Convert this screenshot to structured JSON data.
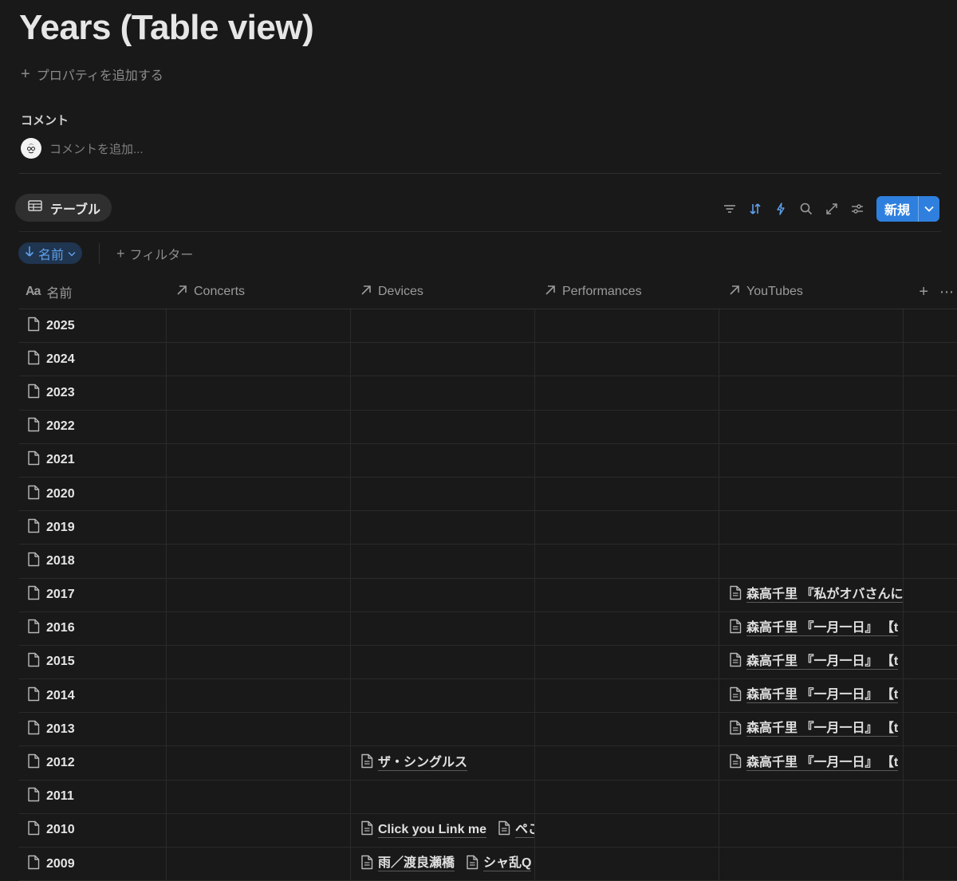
{
  "page": {
    "title": "Years (Table view)",
    "add_property": "プロパティを追加する",
    "comments_label": "コメント",
    "comment_placeholder": "コメントを追加..."
  },
  "view": {
    "tab_label": "テーブル",
    "new_label": "新規",
    "sort_chip": "名前",
    "filter_add": "フィルター"
  },
  "icons": {
    "toolbar": [
      "filter-icon",
      "sort-icon",
      "automation-icon",
      "search-icon",
      "expand-icon",
      "settings-icon"
    ],
    "accent": "#2f80de"
  },
  "columns": {
    "name": "名前",
    "name_prefix": "Aa",
    "concerts": "Concerts",
    "devices": "Devices",
    "performances": "Performances",
    "youtubes": "YouTubes"
  },
  "rows": [
    {
      "year": "2025",
      "concerts": [],
      "devices": [],
      "performances": [],
      "youtubes": []
    },
    {
      "year": "2024",
      "concerts": [],
      "devices": [],
      "performances": [],
      "youtubes": []
    },
    {
      "year": "2023",
      "concerts": [],
      "devices": [],
      "performances": [],
      "youtubes": []
    },
    {
      "year": "2022",
      "concerts": [],
      "devices": [],
      "performances": [],
      "youtubes": []
    },
    {
      "year": "2021",
      "concerts": [],
      "devices": [],
      "performances": [],
      "youtubes": []
    },
    {
      "year": "2020",
      "concerts": [],
      "devices": [],
      "performances": [],
      "youtubes": []
    },
    {
      "year": "2019",
      "concerts": [],
      "devices": [],
      "performances": [],
      "youtubes": []
    },
    {
      "year": "2018",
      "concerts": [],
      "devices": [],
      "performances": [],
      "youtubes": []
    },
    {
      "year": "2017",
      "concerts": [],
      "devices": [],
      "performances": [],
      "youtubes": [
        "森高千里 『私がオバさんに"
      ]
    },
    {
      "year": "2016",
      "concerts": [],
      "devices": [],
      "performances": [],
      "youtubes": [
        "森高千里 『一月一日』 【t"
      ]
    },
    {
      "year": "2015",
      "concerts": [],
      "devices": [],
      "performances": [],
      "youtubes": [
        "森高千里 『一月一日』 【t"
      ]
    },
    {
      "year": "2014",
      "concerts": [],
      "devices": [],
      "performances": [],
      "youtubes": [
        "森高千里 『一月一日』 【t"
      ]
    },
    {
      "year": "2013",
      "concerts": [],
      "devices": [],
      "performances": [],
      "youtubes": [
        "森高千里 『一月一日』 【t"
      ]
    },
    {
      "year": "2012",
      "concerts": [],
      "devices": [
        "ザ・シングルス"
      ],
      "performances": [],
      "youtubes": [
        "森高千里 『一月一日』 【t"
      ]
    },
    {
      "year": "2011",
      "concerts": [],
      "devices": [],
      "performances": [],
      "youtubes": []
    },
    {
      "year": "2010",
      "concerts": [],
      "devices": [
        "Click you Link me",
        "ペこ"
      ],
      "performances": [],
      "youtubes": []
    },
    {
      "year": "2009",
      "concerts": [],
      "devices": [
        "雨／渡良瀬橋",
        "シャ乱Q"
      ],
      "performances": [],
      "youtubes": []
    }
  ]
}
